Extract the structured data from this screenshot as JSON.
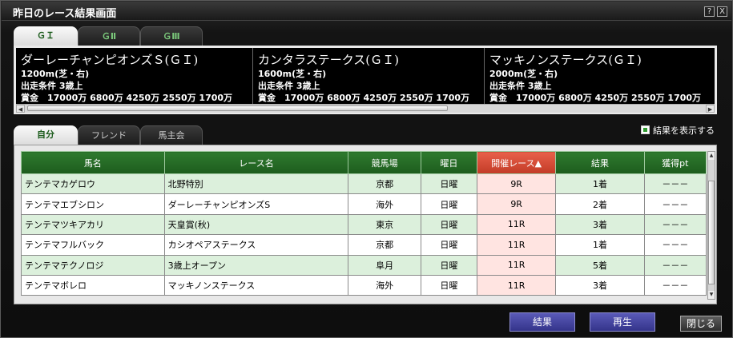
{
  "window": {
    "title": "昨日のレース結果画面",
    "help_label": "?",
    "close_label": "X"
  },
  "race_tabs": [
    {
      "label": "ＧＩ",
      "active": true
    },
    {
      "label": "ＧⅡ",
      "active": false
    },
    {
      "label": "ＧⅢ",
      "active": false
    }
  ],
  "races": [
    {
      "name": "ダーレーチャンピオンズＳ(ＧＩ)",
      "distance": "1200m(芝・右)",
      "condition": "出走条件 3歳上",
      "prize": "賞金　17000万 6800万 4250万 2550万 1700万"
    },
    {
      "name": "カンタラステークス(ＧＩ)",
      "distance": "1600m(芝・右)",
      "condition": "出走条件 3歳上",
      "prize": "賞金　17000万 6800万 4250万 2550万 1700万"
    },
    {
      "name": "マッキノンステークス(ＧＩ)",
      "distance": "2000m(芝・右)",
      "condition": "出走条件 3歳上",
      "prize": "賞金　17000万 6800万 4250万 2550万 1700万"
    }
  ],
  "result_tabs": [
    {
      "label": "自分",
      "active": true
    },
    {
      "label": "フレンド",
      "active": false
    },
    {
      "label": "馬主会",
      "active": false
    }
  ],
  "show_results": {
    "label": "結果を表示する",
    "checked": true
  },
  "table": {
    "headers": [
      "馬名",
      "レース名",
      "競馬場",
      "曜日",
      "開催レース▲",
      "結果",
      "獲得pt"
    ],
    "rows": [
      [
        "テンテマカゲロウ",
        "北野特別",
        "京都",
        "日曜",
        "9R",
        "1着",
        "－－－"
      ],
      [
        "テンテマエブシロン",
        "ダーレーチャンピオンズS",
        "海外",
        "日曜",
        "9R",
        "2着",
        "－－－"
      ],
      [
        "テンテマツキアカリ",
        "天皇賞(秋)",
        "東京",
        "日曜",
        "11R",
        "3着",
        "－－－"
      ],
      [
        "テンテマフルバック",
        "カシオペアステークス",
        "京都",
        "日曜",
        "11R",
        "1着",
        "－－－"
      ],
      [
        "テンテマテクノロジ",
        "3歳上オープン",
        "阜月",
        "日曜",
        "11R",
        "5着",
        "－－－"
      ],
      [
        "テンテマボレロ",
        "マッキノンステークス",
        "海外",
        "日曜",
        "11R",
        "3着",
        "－－－"
      ]
    ]
  },
  "buttons": {
    "result": "結果",
    "replay": "再生",
    "close": "閉じる"
  },
  "colors": {
    "header_green": "#2f7a2f",
    "sorted_header": "#c23b26",
    "row_green": "#dcf0dc",
    "button_blue": "#4848a8"
  }
}
